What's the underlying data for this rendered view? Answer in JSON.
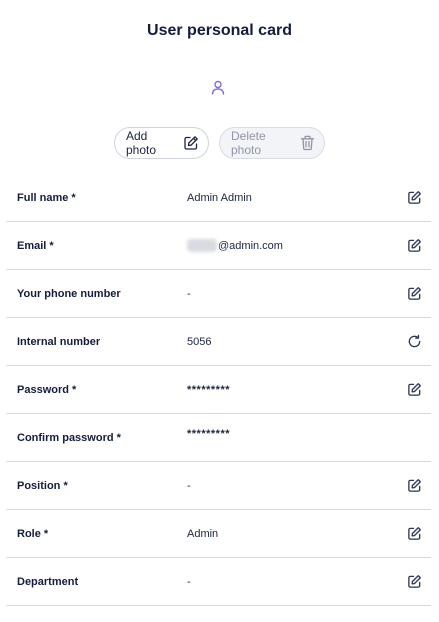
{
  "page": {
    "title": "User personal card"
  },
  "avatar": {
    "icon": "user-icon",
    "color": "#7b6fd6"
  },
  "photo_actions": {
    "add_label": "Add photo",
    "add_icon": "edit-icon",
    "delete_label": "Delete photo",
    "delete_icon": "trash-icon"
  },
  "fields": [
    {
      "label": "Full name *",
      "value": "Admin Admin",
      "action": "edit-icon"
    },
    {
      "label": "Email *",
      "value": "@admin.com",
      "value_prefix_redacted": true,
      "action": "edit-icon"
    },
    {
      "label": "Your phone number",
      "value": "-",
      "action": "edit-icon"
    },
    {
      "label": "Internal number",
      "value": "5056",
      "action": "refresh-icon"
    },
    {
      "label": "Password *",
      "value": "*********",
      "action": "edit-icon"
    },
    {
      "label": "Confirm password *",
      "value": "*********",
      "action": ""
    },
    {
      "label": "Position *",
      "value": "-",
      "action": "edit-icon"
    },
    {
      "label": "Role *",
      "value": "Admin",
      "action": "edit-icon"
    },
    {
      "label": "Department",
      "value": "-",
      "action": "edit-icon"
    }
  ]
}
